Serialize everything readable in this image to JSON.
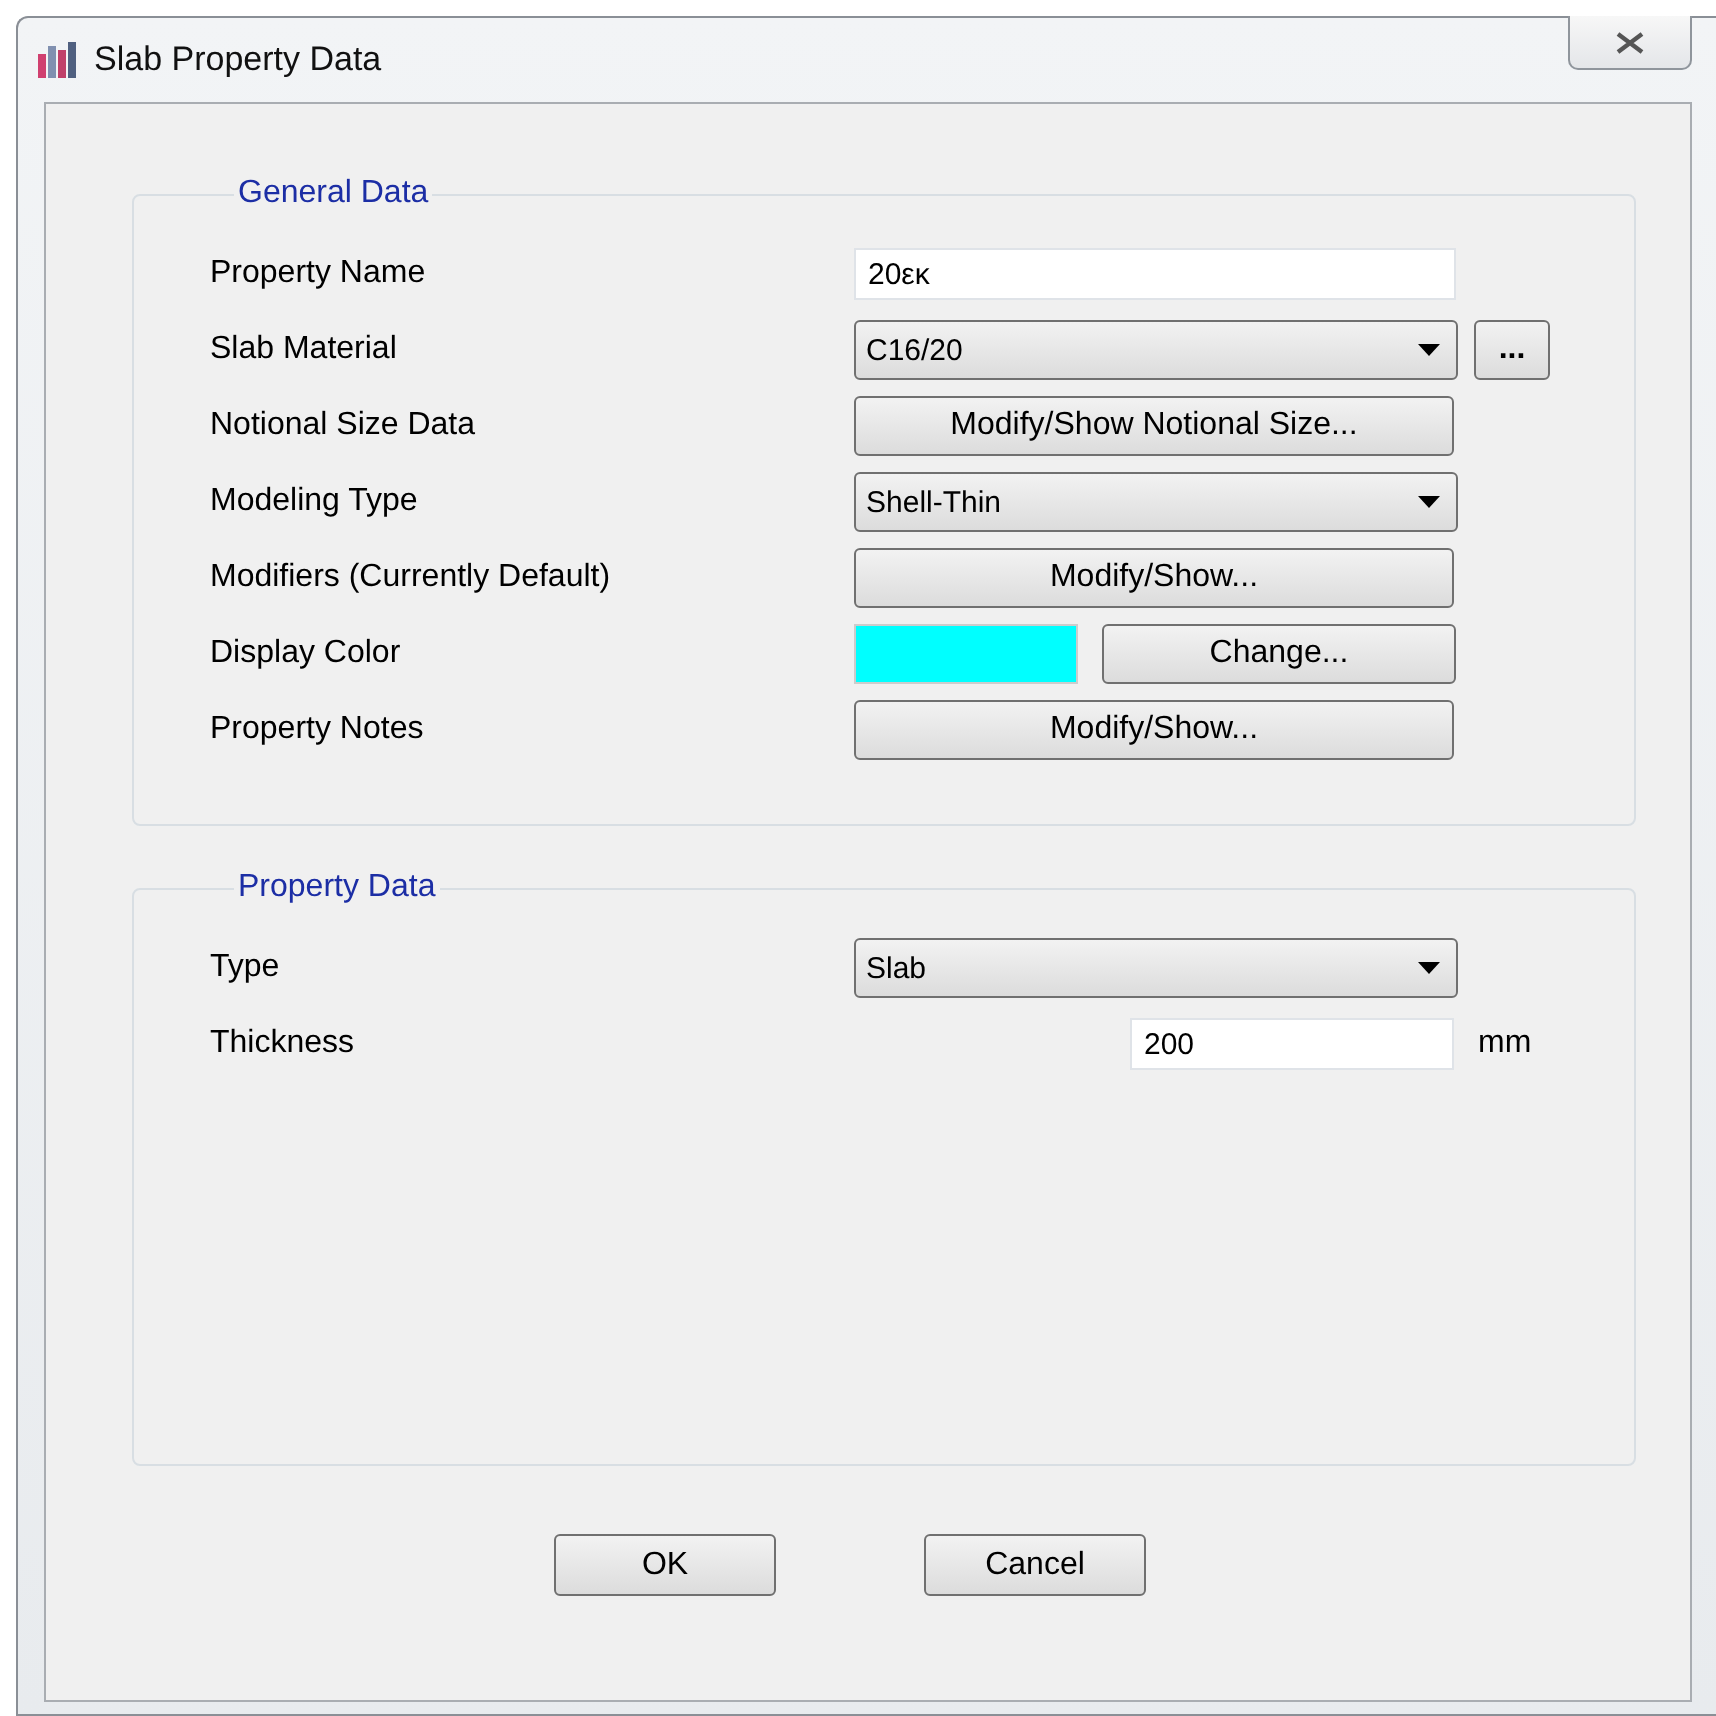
{
  "window": {
    "title": "Slab Property Data"
  },
  "general_data": {
    "title": "General Data",
    "rows": [
      {
        "label": "Property Name",
        "kind": "text",
        "value": "20εκ"
      },
      {
        "label": "Slab Material",
        "kind": "dropdown_more",
        "value": "C16/20",
        "more": "..."
      },
      {
        "label": "Notional Size Data",
        "kind": "button",
        "button": "Modify/Show Notional Size..."
      },
      {
        "label": "Modeling Type",
        "kind": "dropdown",
        "value": "Shell-Thin"
      },
      {
        "label": "Modifiers (Currently Default)",
        "kind": "button",
        "button": "Modify/Show..."
      },
      {
        "label": "Display Color",
        "kind": "color",
        "color": "#00ffff",
        "button": "Change..."
      },
      {
        "label": "Property Notes",
        "kind": "button",
        "button": "Modify/Show..."
      }
    ]
  },
  "property_data": {
    "title": "Property Data",
    "rows": [
      {
        "label": "Type",
        "kind": "dropdown",
        "value": "Slab"
      },
      {
        "label": "Thickness",
        "kind": "unit_field",
        "value": "200",
        "unit": "mm"
      }
    ]
  },
  "buttons": [
    "OK",
    "Cancel"
  ]
}
